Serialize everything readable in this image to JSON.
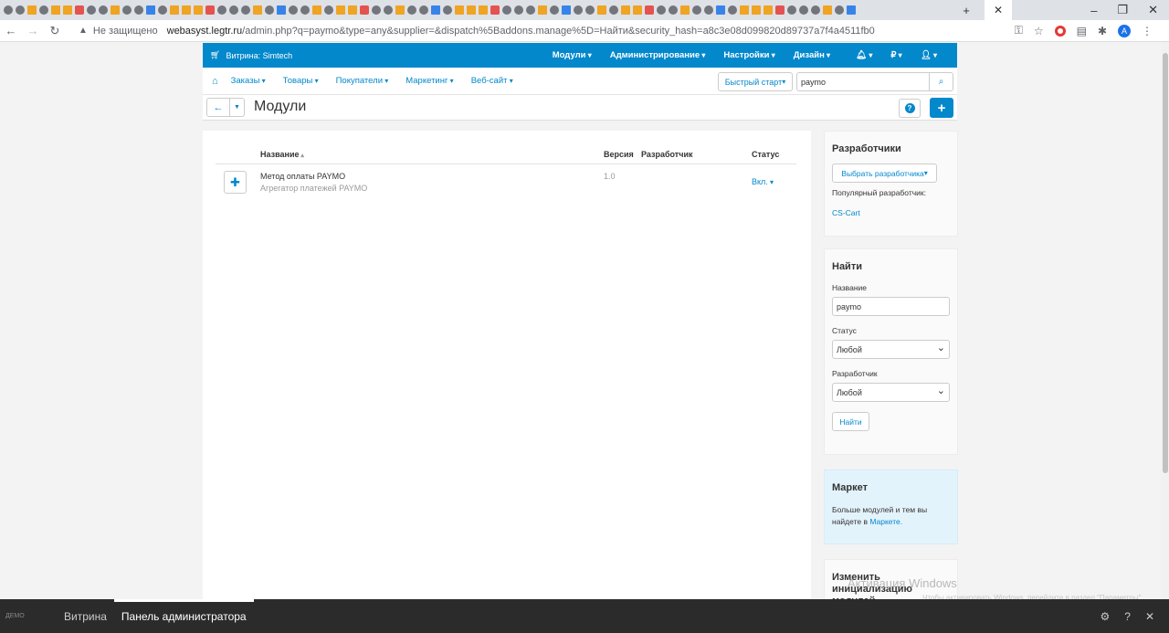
{
  "browser": {
    "active_tab_close": "✕",
    "new_tab": "+",
    "minimize": "–",
    "restore": "❐",
    "close": "✕",
    "security_label": "Не защищено",
    "url_host": "webasyst.legtr.ru",
    "url_path": "/admin.php?q=paymo&type=any&supplier=&dispatch%5Baddons.manage%5D=Найти&security_hash=a8c3e08d099820d89737a7f4a4511fb0",
    "profile_initial": "A"
  },
  "admin": {
    "store_label": "Витрина: Simtech",
    "top_menu": [
      "Модули",
      "Администрирование",
      "Настройки",
      "Дизайн"
    ],
    "currency": "₽",
    "sub_menu": [
      "Заказы",
      "Товары",
      "Покупатели",
      "Маркетинг",
      "Веб-сайт"
    ],
    "quick_start": "Быстрый старт",
    "search_value": "paymo",
    "page_title": "Модули"
  },
  "table": {
    "columns": {
      "name": "Название",
      "version": "Версия",
      "developer": "Разработчик",
      "status": "Статус"
    },
    "rows": [
      {
        "name": "Метод оплаты PAYMO",
        "description": "Агрегатор платежей PAYMO",
        "version": "1.0",
        "developer": "",
        "status": "Вкл."
      }
    ]
  },
  "sidebar": {
    "developers": {
      "title": "Разработчики",
      "select_button": "Выбрать разработчика",
      "popular_label": "Популярный разработчик:",
      "popular_link": "CS-Cart"
    },
    "find": {
      "title": "Найти",
      "name_label": "Название",
      "name_value": "paymo",
      "status_label": "Статус",
      "status_value": "Любой",
      "developer_label": "Разработчик",
      "developer_value": "Любой",
      "submit": "Найти"
    },
    "market": {
      "title": "Маркет",
      "text": "Больше модулей и тем вы найдете в",
      "link": "Маркете."
    },
    "reinit": {
      "title": "Изменить инициализацию модулей"
    }
  },
  "watermark": {
    "line1": "Активация Windows",
    "line2": "Чтобы активировать Windows, перейдите в раздел \"Параметры\"."
  },
  "bottom_bar": {
    "logo": "ДЕМО",
    "storefront": "Витрина",
    "admin_panel": "Панель администратора"
  }
}
